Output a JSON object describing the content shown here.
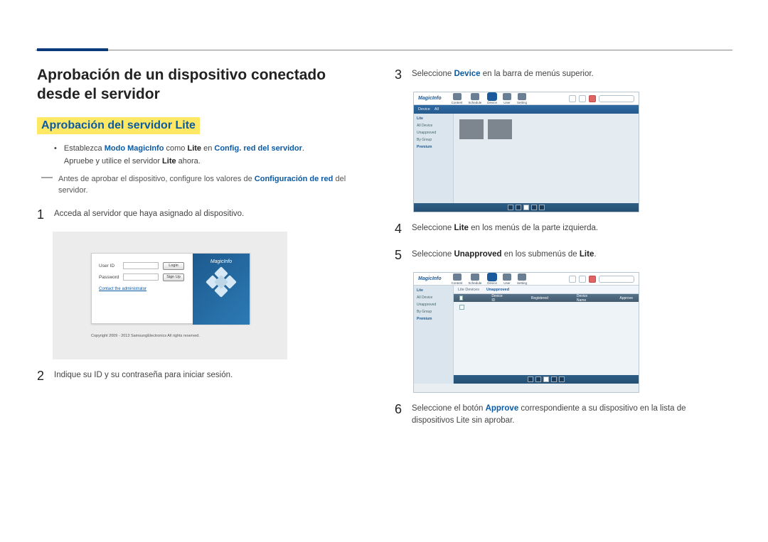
{
  "page": {
    "title": "Aprobación de un dispositivo conectado desde el servidor",
    "subhead": "Aprobación del servidor Lite"
  },
  "bullets": {
    "b1_pre": "Establezca ",
    "b1_bold1": "Modo MagicInfo",
    "b1_mid1": " como ",
    "b1_bold2": "Lite",
    "b1_mid2": " en ",
    "b1_bold3": "Config. red del servidor",
    "b1_end": ".",
    "b2_pre": "Apruebe y utilice el servidor ",
    "b2_bold": "Lite",
    "b2_end": " ahora."
  },
  "note": {
    "pre": "Antes de aprobar el dispositivo, configure los valores de ",
    "bold": "Configuración de red",
    "end": " del servidor."
  },
  "steps": {
    "s1_num": "1",
    "s1_text": "Acceda al servidor que haya asignado al dispositivo.",
    "s2_num": "2",
    "s2_text": "Indique su ID y su contraseña para iniciar sesión.",
    "s3_num": "3",
    "s3_pre": "Seleccione ",
    "s3_bold": "Device",
    "s3_end": " en la barra de menús superior.",
    "s4_num": "4",
    "s4_pre": "Seleccione ",
    "s4_bold": "Lite",
    "s4_end": " en los menús de la parte izquierda.",
    "s5_num": "5",
    "s5_pre": "Seleccione ",
    "s5_bold": "Unapproved",
    "s5_end": " en los submenús de ",
    "s5_bold2": "Lite",
    "s5_end2": ".",
    "s6_num": "6",
    "s6_pre": "Seleccione el botón ",
    "s6_bold": "Approve",
    "s6_end": " correspondiente a su dispositivo en la lista de dispositivos Lite sin aprobar."
  },
  "login": {
    "brand": "MagicInfo",
    "user_label": "User ID",
    "pass_label": "Password",
    "login_btn": "Login",
    "signup_btn": "Sign Up",
    "contact_link": "Contact the administrator",
    "copyright": "Copyright 2009 - 2013 SamsungElectronics All rights reserved."
  },
  "app": {
    "logo": "MagicInfo",
    "tabs": {
      "content": "Content",
      "schedule": "Schedule",
      "device": "Device",
      "user": "User",
      "setting": "Setting"
    },
    "bluebar": {
      "item1": "Device",
      "item2": "All"
    },
    "sidebar": {
      "lite": "Lite",
      "all": "All Device",
      "unapproved": "Unapproved",
      "group": "By Group",
      "premium": "Premium"
    },
    "subtabs": {
      "lite_devices": "Lite Devices",
      "unapproved": "Unapproved"
    },
    "table": {
      "col1": "Device ID",
      "col2": "Registered",
      "col3": "Device Name",
      "col4": "Approve"
    }
  }
}
